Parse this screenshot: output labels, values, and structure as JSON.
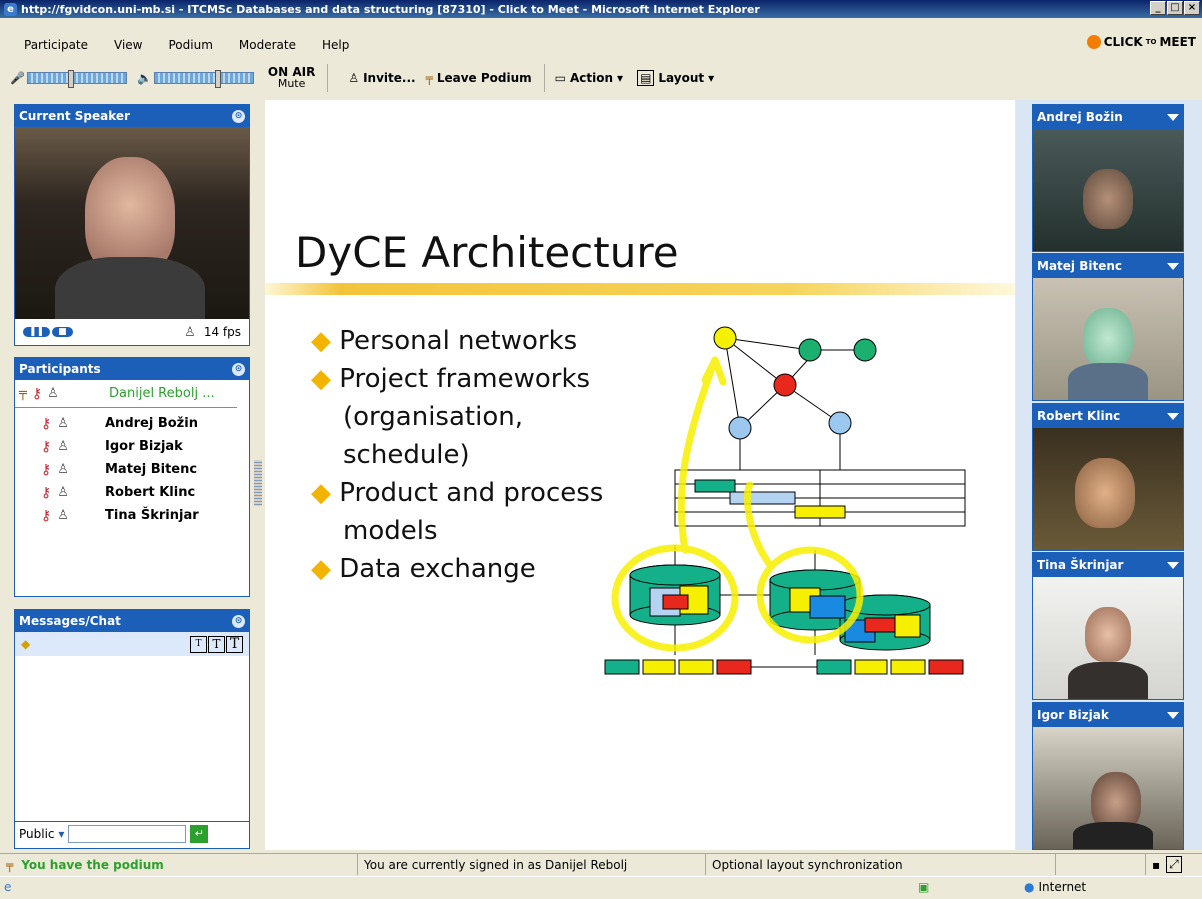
{
  "window": {
    "title": "http://fgvidcon.uni-mb.si - ITCMSc Databases and data structuring [87310] - Click to Meet - Microsoft Internet Explorer"
  },
  "menu": [
    "Participate",
    "View",
    "Podium",
    "Moderate",
    "Help"
  ],
  "logo": {
    "text": "CLICK",
    "small": "TO",
    "tail": "MEET"
  },
  "toolbar": {
    "on_air": "ON AIR",
    "mute": "Mute",
    "invite": "Invite...",
    "leave": "Leave Podium",
    "action": "Action",
    "layout": "Layout"
  },
  "speaker": {
    "title": "Current Speaker",
    "fps": "14 fps"
  },
  "participants": {
    "title": "Participants",
    "host": "Danijel Rebolj ...",
    "members": [
      "Andrej Božin",
      "Igor Bizjak",
      "Matej Bitenc",
      "Robert Klinc",
      "Tina Škrinjar"
    ]
  },
  "chat": {
    "title": "Messages/Chat",
    "scope": "Public",
    "fonts": [
      "T",
      "T",
      "T"
    ]
  },
  "slide": {
    "title": "DyCE Architecture",
    "bullets": [
      "Personal networks",
      "Project frameworks",
      "(organisation,",
      "schedule)",
      "Product and process",
      "models",
      "Data exchange"
    ]
  },
  "cameras": [
    "Andrej Božin",
    "Matej Bitenc",
    "Robert Klinc",
    "Tina Škrinjar",
    "Igor Bizjak"
  ],
  "status": {
    "podium": "You have the podium",
    "signed": "You are currently signed in as Danijel Rebolj",
    "sync": "Optional layout synchronization"
  },
  "ie": {
    "zone": "Internet"
  },
  "colors": {
    "accent": "#1c5fb9",
    "host_name": "#2ca02c"
  }
}
